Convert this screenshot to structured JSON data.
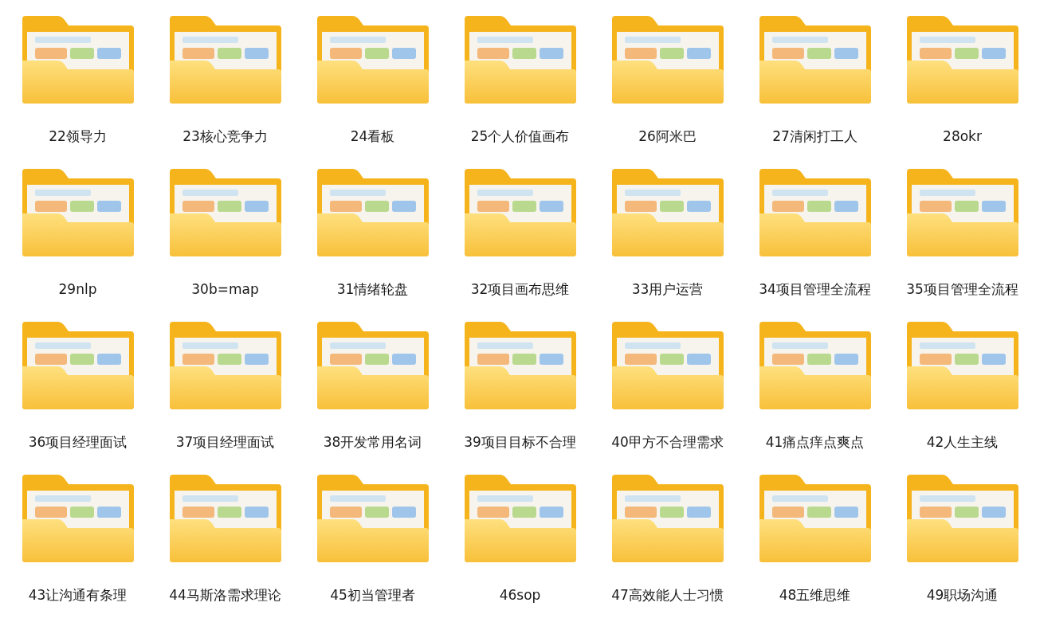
{
  "folders": [
    {
      "name": "22领导力"
    },
    {
      "name": "23核心竞争力"
    },
    {
      "name": "24看板"
    },
    {
      "name": "25个人价值画布"
    },
    {
      "name": "26阿米巴"
    },
    {
      "name": "27清闲打工人"
    },
    {
      "name": "28okr"
    },
    {
      "name": "29nlp"
    },
    {
      "name": "30b=map"
    },
    {
      "name": "31情绪轮盘"
    },
    {
      "name": "32项目画布思维"
    },
    {
      "name": "33用户运营"
    },
    {
      "name": "34项目管理全流程"
    },
    {
      "name": "35项目管理全流程"
    },
    {
      "name": "36项目经理面试"
    },
    {
      "name": "37项目经理面试"
    },
    {
      "name": "38开发常用名词"
    },
    {
      "name": "39项目目标不合理"
    },
    {
      "name": "40甲方不合理需求"
    },
    {
      "name": "41痛点痒点爽点"
    },
    {
      "name": "42人生主线"
    },
    {
      "name": "43让沟通有条理"
    },
    {
      "name": "44马斯洛需求理论"
    },
    {
      "name": "45初当管理者"
    },
    {
      "name": "46sop"
    },
    {
      "name": "47高效能人士习惯"
    },
    {
      "name": "48五维思维"
    },
    {
      "name": "49职场沟通"
    }
  ]
}
